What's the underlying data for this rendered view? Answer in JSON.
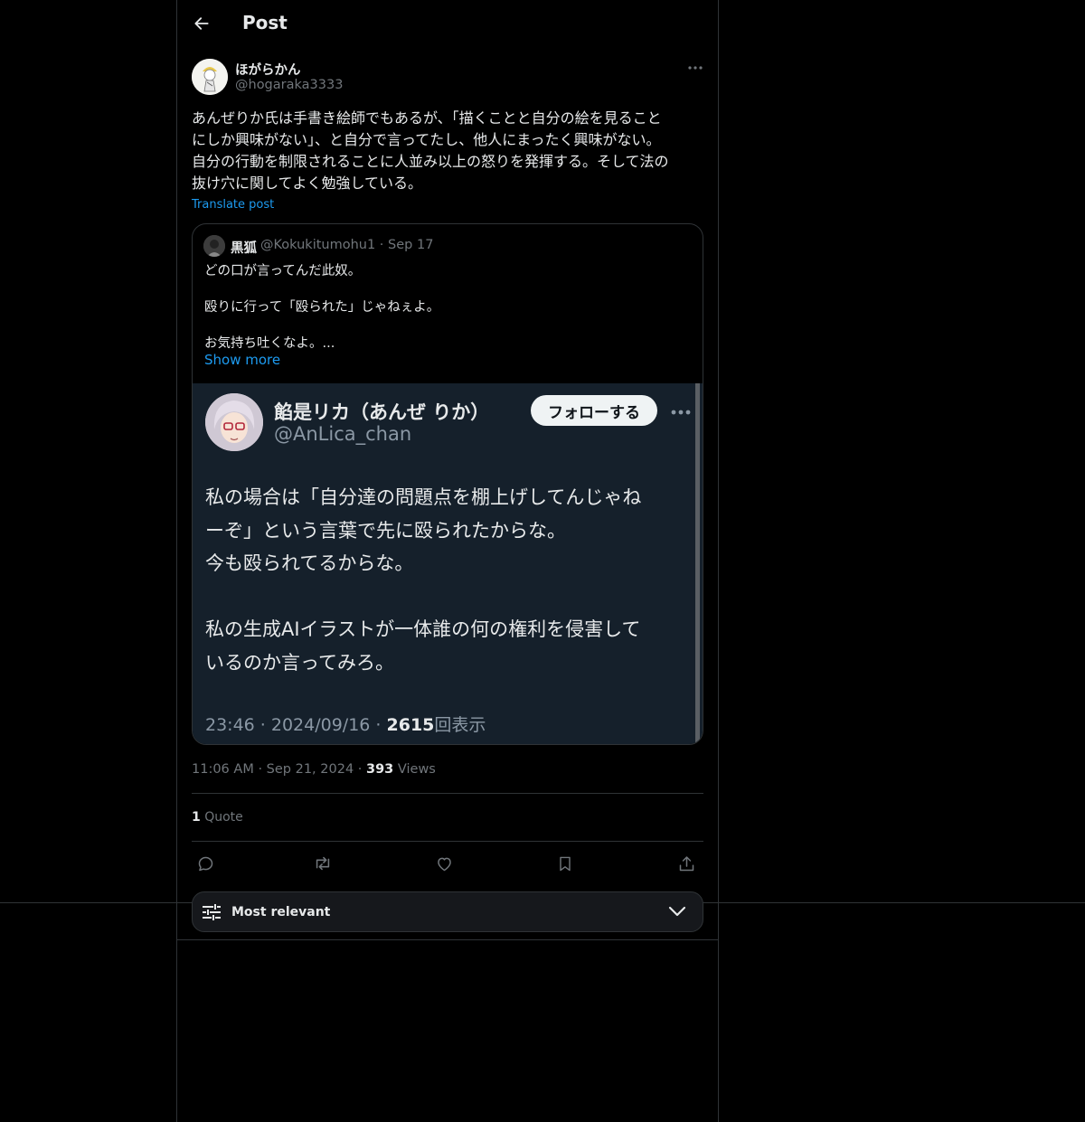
{
  "topbar": {
    "title": "Post"
  },
  "post": {
    "author_name": "ほがらかん",
    "author_handle": "@hogaraka3333",
    "text": "あんぜりか氏は手書き絵師でもあるが、「描くことと自分の絵を見ること\nにしか興味がない」、と自分で言ってたし、他人にまったく興味がない。\n自分の行動を制限されることに人並み以上の怒りを発揮する。そして法の\n抜け穴に関してよく勉強している。",
    "translate_label": "Translate post",
    "time": "11:06 AM",
    "date": "Sep 21, 2024",
    "views_count": "393",
    "views_label": "Views",
    "quote_count": "1",
    "quote_label": "Quote"
  },
  "quoted": {
    "name": "黒狐",
    "handle": "@Kokukitumohu1 · Sep 17",
    "text": "どの口が言ってんだ此奴。\n\n殴りに行って「殴られた」じゃねぇよ。\n\nお気持ち吐くなよ。...",
    "show_more": "Show more",
    "screenshot": {
      "name": "餡是リカ（あんぜ りか）",
      "handle": "@AnLica_chan",
      "follow_label": "フォローする",
      "body": "私の場合は「自分達の問題点を棚上げしてんじゃね\nーぞ」という言葉で先に殴られたからな。\n今も殴られてるからな。\n\n私の生成AIイラストが一体誰の何の権利を侵害して\nいるのか言ってみろ。",
      "footer_meta": "23:46 · 2024/09/16 · ",
      "footer_views": "2615",
      "footer_views_label": "回表示"
    }
  },
  "sort": {
    "label": "Most relevant"
  },
  "icons": {
    "back": "arrow-left-icon",
    "more": "more-horizontal-icon",
    "reply": "reply-icon",
    "repost": "repost-icon",
    "like": "heart-icon",
    "bookmark": "bookmark-icon",
    "share": "share-icon",
    "sort": "sliders-icon",
    "chevron": "chevron-down-icon"
  },
  "colors": {
    "background": "#000000",
    "text": "#e7e9ea",
    "secondary": "#71767b",
    "accent": "#1d9bf0",
    "border": "#2f3336",
    "embedded_background": "#15202b"
  }
}
